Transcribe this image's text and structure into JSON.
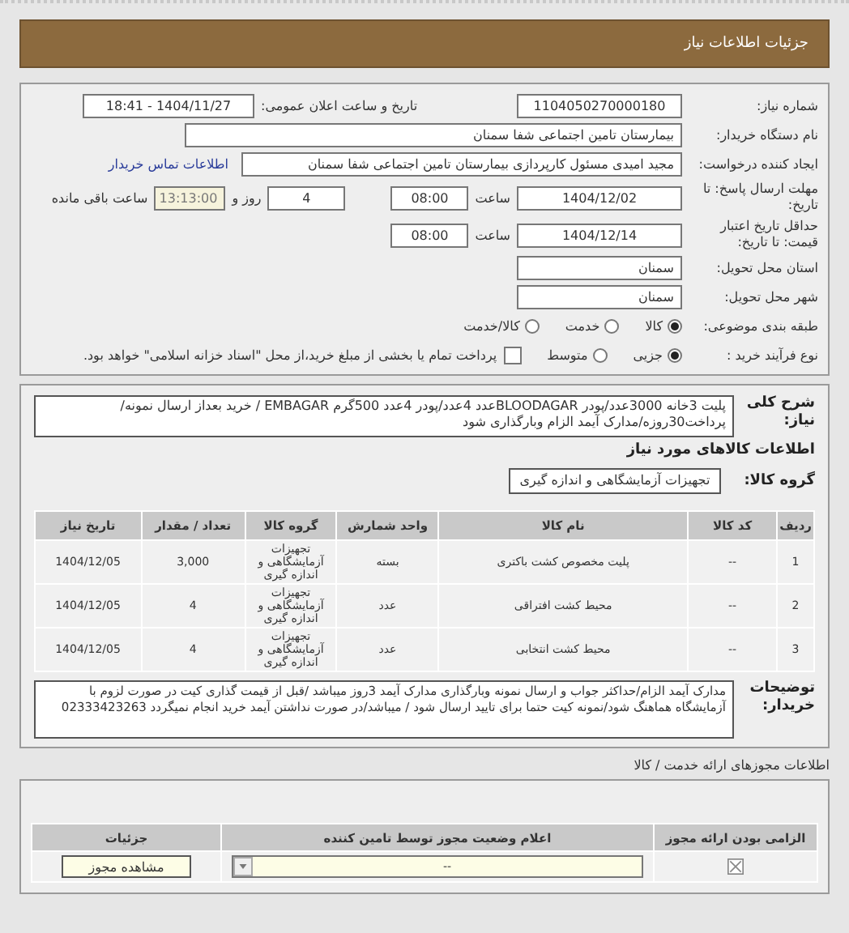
{
  "header": {
    "title": "جزئیات اطلاعات نیاز"
  },
  "form": {
    "need_number": {
      "label": "شماره نیاز:",
      "value": "1104050270000180"
    },
    "announce": {
      "label": "تاریخ و ساعت اعلان عمومی:",
      "value": "1404/11/27 - 18:41"
    },
    "buyer_org": {
      "label": "نام دستگاه خریدار:",
      "value": "بیمارستان تامین اجتماعی شفا سمنان"
    },
    "creator": {
      "label": "ایجاد کننده درخواست:",
      "value": "مجید امیدی مسئول کارپردازی بیمارستان تامین اجتماعی شفا سمنان"
    },
    "contact_link": "اطلاعات تماس خریدار",
    "deadline": {
      "label": "مهلت ارسال پاسخ: تا تاریخ:",
      "date": "1404/12/02",
      "time_label": "ساعت",
      "time": "08:00",
      "days": "4",
      "days_label": "روز و",
      "remaining": "13:13:00",
      "remaining_label": "ساعت باقی مانده"
    },
    "validity": {
      "label": "حداقل تاریخ اعتبار قیمت: تا تاریخ:",
      "date": "1404/12/14",
      "time_label": "ساعت",
      "time": "08:00"
    },
    "province": {
      "label": "استان محل تحویل:",
      "value": "سمنان"
    },
    "city": {
      "label": "شهر محل تحویل:",
      "value": "سمنان"
    },
    "category": {
      "label": "طبقه بندی موضوعی:",
      "options": [
        {
          "label": "کالا",
          "selected": true
        },
        {
          "label": "خدمت",
          "selected": false
        },
        {
          "label": "کالا/خدمت",
          "selected": false
        }
      ]
    },
    "process": {
      "label": "نوع فرآیند خرید :",
      "options": [
        {
          "label": "جزیی",
          "selected": true
        },
        {
          "label": "متوسط",
          "selected": false
        }
      ],
      "treasury": {
        "label": "پرداخت تمام یا بخشی از مبلغ خرید،از محل \"اسناد خزانه اسلامی\" خواهد بود.",
        "checked": false
      }
    }
  },
  "need": {
    "description_label": "شرح کلی نیاز:",
    "description": "پلیت 3خانه 3000عدد/پودر BLOODAGARعدد 4عدد/پودر 4عدد 500گرم EMBAGAR / خرید بعداز ارسال نمونه/ پرداخت30روزه/مدارک آیمد الزام وبارگذاری شود",
    "goods_title": "اطلاعات کالاهای مورد نیاز",
    "group_label": "گروه کالا:",
    "group": "تجهیزات آزمایشگاهی و اندازه گیری",
    "table": {
      "columns": [
        "ردیف",
        "کد کالا",
        "نام کالا",
        "واحد شمارش",
        "گروه کالا",
        "تعداد / مقدار",
        "تاریخ نیاز"
      ],
      "rows": [
        [
          "1",
          "--",
          "پلیت مخصوص کشت باکتری",
          "بسته",
          "تجهیزات آزمایشگاهی و اندازه گیری",
          "3,000",
          "1404/12/05"
        ],
        [
          "2",
          "--",
          "محیط کشت افتراقی",
          "عدد",
          "تجهیزات آزمایشگاهی و اندازه گیری",
          "4",
          "1404/12/05"
        ],
        [
          "3",
          "--",
          "محیط کشت انتخابی",
          "عدد",
          "تجهیزات آزمایشگاهی و اندازه گیری",
          "4",
          "1404/12/05"
        ]
      ]
    },
    "notes_label": "توضیحات خریدار:",
    "notes": "مدارک آیمد الزام/حداکثر جواب و ارسال نمونه وبارگذاری مدارک آیمد 3روز میباشد /قبل از قیمت گذاری کیت در صورت لزوم با آزمایشگاه هماهنگ شود/نمونه کیت حتما برای تایید ارسال شود / میباشد/در صورت نداشتن آیمد خرید انجام نمیگردد 02333423263"
  },
  "permits": {
    "title": "اطلاعات مجوزهای ارائه خدمت / کالا",
    "columns": [
      "الزامی بودن ارائه مجوز",
      "اعلام وضعیت مجوز توسط تامین کننده",
      "جزئیات"
    ],
    "rows": [
      {
        "required": true,
        "status": "--",
        "button": "مشاهده مجوز"
      }
    ]
  }
}
